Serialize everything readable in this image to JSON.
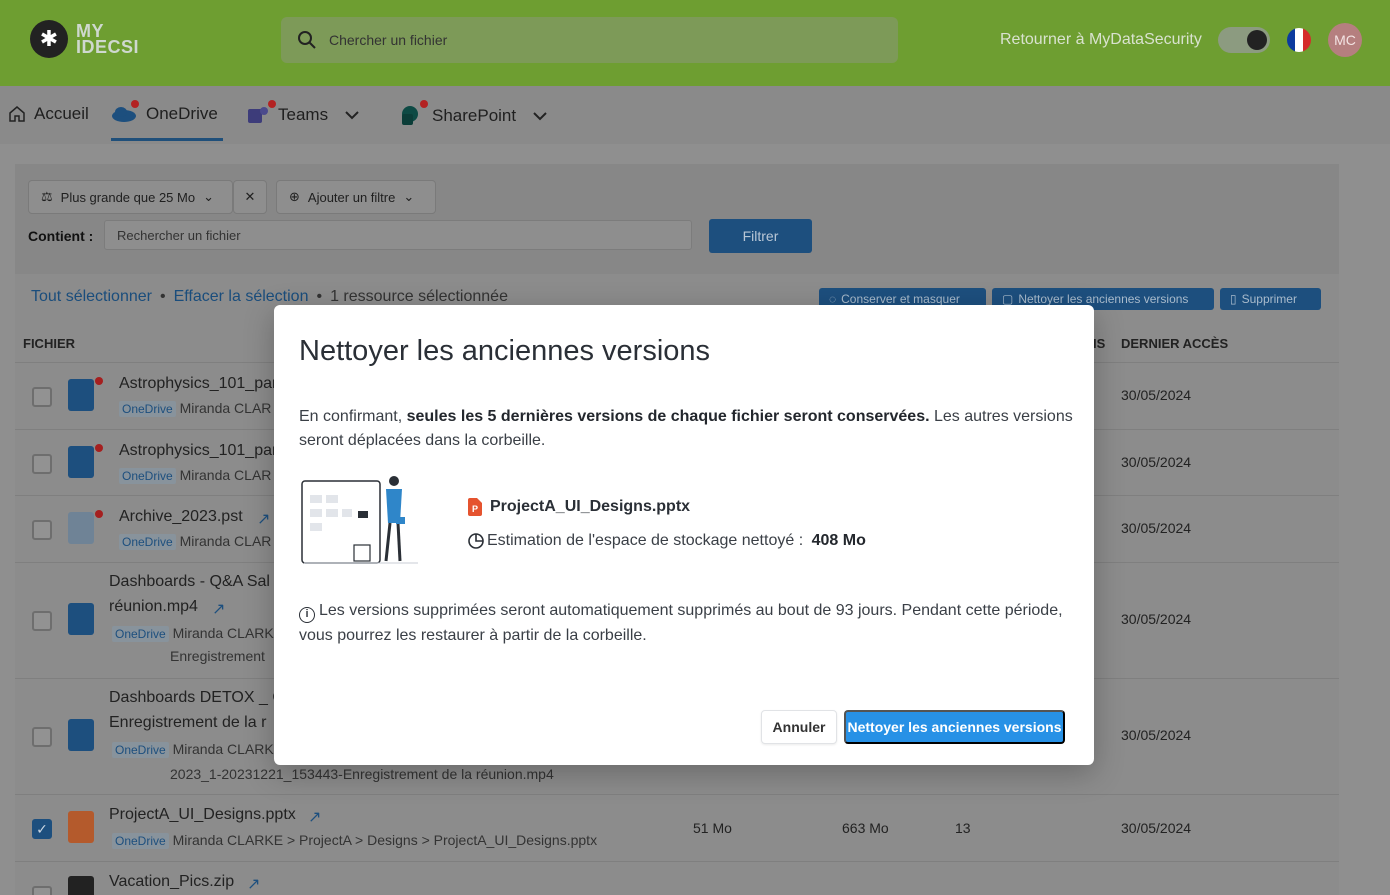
{
  "header": {
    "logo_mark": "✱",
    "logo_line1": "MY",
    "logo_line2": "IDECSI",
    "search_placeholder": "Chercher un fichier",
    "return_label": "Retourner à MyDataSecurity",
    "avatar_initials": "MC",
    "flag_colors": [
      "#0b3a9e",
      "#ffffff",
      "#d52b2b"
    ]
  },
  "nav": {
    "home": "Accueil",
    "onedrive": "OneDrive",
    "teams": "Teams",
    "sharepoint": "SharePoint"
  },
  "filters": {
    "size_chip": "Plus grande que 25 Mo",
    "add_filter": "Ajouter un filtre",
    "contient_label": "Contient :",
    "contient_placeholder": "Rechercher un fichier",
    "filter_button": "Filtrer"
  },
  "selection": {
    "select_all": "Tout sélectionner",
    "clear": "Effacer la sélection",
    "separator": "•",
    "count": "1 ressource sélectionnée",
    "actions": [
      "Conserver et masquer",
      "Nettoyer les anciennes versions",
      "Supprimer"
    ]
  },
  "table": {
    "headers": {
      "file": "FICHIER",
      "versions_partial": "IS",
      "last_access": "DERNIER ACCÈS"
    },
    "badge": "OneDrive",
    "rows": [
      {
        "name": "Astrophysics_101_par",
        "sub": "Miranda CLAR",
        "date": "30/05/2024"
      },
      {
        "name": "Astrophysics_101_par",
        "sub": "Miranda CLAR",
        "date": "30/05/2024"
      },
      {
        "name": "Archive_2023.pst",
        "sub": "Miranda CLAR",
        "date": "30/05/2024"
      },
      {
        "name": "Dashboards - Q&A Sal",
        "name2": "réunion.mp4",
        "sub": "Miranda CLARK",
        "sub2": "Enregistrement",
        "date": "30/05/2024"
      },
      {
        "name": "Dashboards DETOX _ C",
        "name2": "Enregistrement de la r",
        "sub": "Miranda CLARK",
        "sub2": "2023_1-20231221_153443-Enregistrement de la réunion.mp4",
        "date": "30/05/2024"
      },
      {
        "name": "ProjectA_UI_Designs.pptx",
        "sub": "Miranda CLARKE > ProjectA > Designs > ProjectA_UI_Designs.pptx",
        "size": "51 Mo",
        "total": "663 Mo",
        "versions": "13",
        "date": "30/05/2024"
      },
      {
        "name": "Vacation_Pics.zip"
      }
    ]
  },
  "modal": {
    "title": "Nettoyer les anciennes versions",
    "desc_pre": "En confirmant,",
    "desc_bold": "seules les 5 dernières versions de chaque fichier seront conservées.",
    "desc_post": "Les autres versions seront déplacées dans la corbeille.",
    "file_name": "ProjectA_UI_Designs.pptx",
    "estimate_label": "Estimation de l'espace de stockage nettoyé :",
    "estimate_value": "408 Mo",
    "note": "Les versions supprimées seront automatiquement supprimés au bout de 93 jours. Pendant cette période, vous pourrez les restaurer à partir de la corbeille.",
    "cancel": "Annuler",
    "confirm": "Nettoyer les anciennes versions"
  }
}
